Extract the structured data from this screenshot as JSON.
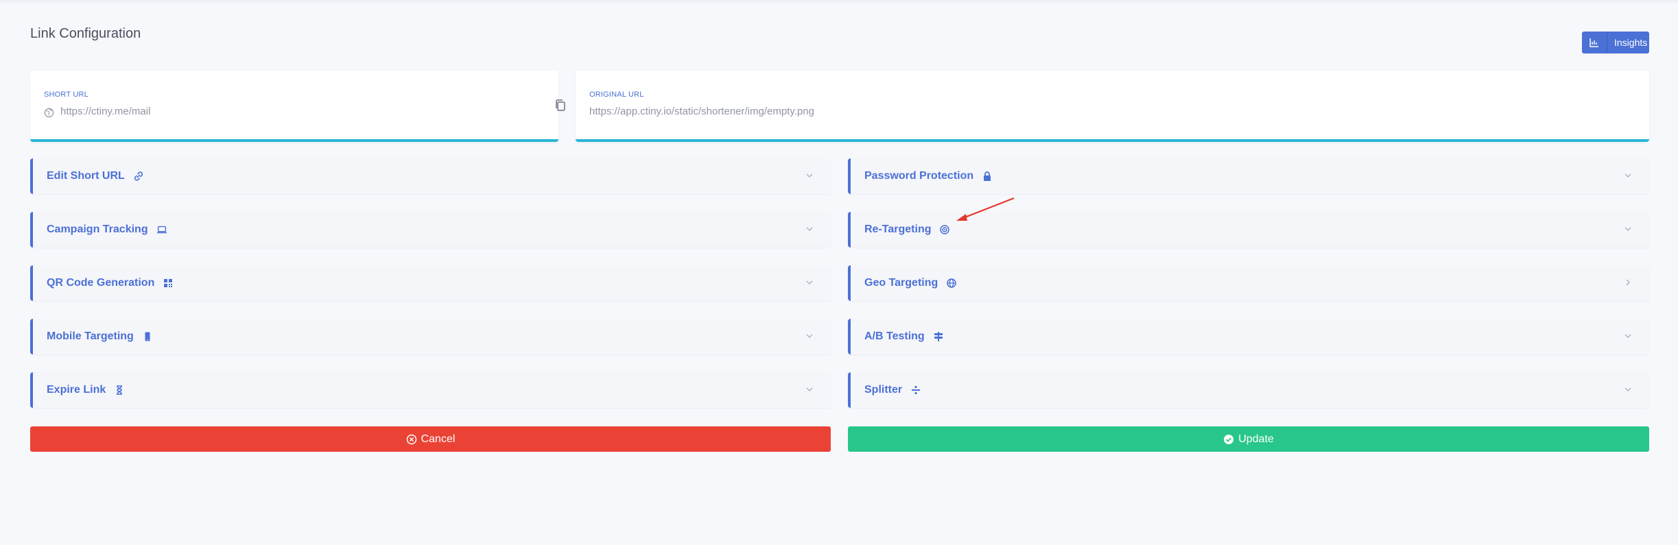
{
  "page": {
    "title": "Link Configuration"
  },
  "header": {
    "insights_label": "Insights"
  },
  "short_url": {
    "label": "SHORT URL",
    "value": "https://ctiny.me/mail"
  },
  "original_url": {
    "label": "ORIGINAL URL",
    "value": "https://app.ctiny.io/static/shortener/img/empty.png"
  },
  "sections_left": [
    {
      "label": "Edit Short URL",
      "icon": "link-icon"
    },
    {
      "label": "Campaign Tracking",
      "icon": "laptop-icon"
    },
    {
      "label": "QR Code Generation",
      "icon": "qrcode-icon"
    },
    {
      "label": "Mobile Targeting",
      "icon": "mobile-icon"
    },
    {
      "label": "Expire Link",
      "icon": "hourglass-icon"
    }
  ],
  "sections_right": [
    {
      "label": "Password Protection",
      "icon": "lock-icon"
    },
    {
      "label": "Re-Targeting",
      "icon": "bullseye-icon"
    },
    {
      "label": "Geo Targeting",
      "icon": "globe-icon",
      "collapsed_right": true
    },
    {
      "label": "A/B Testing",
      "icon": "signs-icon"
    },
    {
      "label": "Splitter",
      "icon": "divide-icon"
    }
  ],
  "actions": {
    "cancel_label": "Cancel",
    "update_label": "Update"
  },
  "colors": {
    "accent": "#4b70d6",
    "cancel": "#ea4335",
    "update": "#28c68a",
    "card_border": "#28b6d4",
    "annotation_arrow": "#e5372b"
  }
}
